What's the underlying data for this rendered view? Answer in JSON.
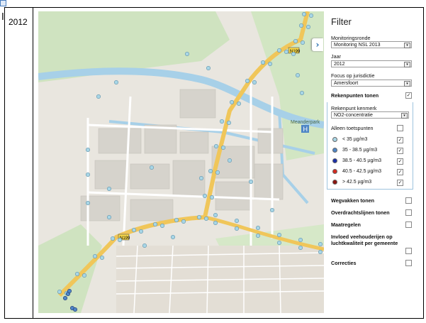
{
  "year_cell": {
    "value": "2012"
  },
  "map": {
    "area_labels": {
      "meanderpark": "Meanderpark",
      "hospital": "H"
    },
    "route_shields": [
      "N199",
      "N199"
    ],
    "point_color_low": "#a8d6e6",
    "road_color": "#f0c65a",
    "water_color": "#a7d0e8"
  },
  "filter": {
    "title": "Filter",
    "monitoringsronde_label": "Monitoringsronde",
    "monitoringsronde_value": "Monitoring NSL 2013",
    "jaar_label": "Jaar",
    "jaar_value": "2012",
    "jurisdictie_label": "Focus op jurisdictie",
    "jurisdictie_value": "Amersfoort",
    "rekenpunten_label": "Rekenpunten tonen",
    "kenmerk_label": "Rekenpunt kenmerk",
    "kenmerk_value": "NO2-concentratie",
    "toetspunten_label": "Alleen toetspunten",
    "legend": [
      {
        "label": "< 35 µg/m3",
        "color": "#a8d6e6",
        "checked": "✓"
      },
      {
        "label": "35 - 38.5 µg/m3",
        "color": "#4f86c6",
        "checked": "✓"
      },
      {
        "label": "38.5 - 40.5 µg/m3",
        "color": "#1a2fa8",
        "checked": "✓"
      },
      {
        "label": "40.5 - 42.5 µg/m3",
        "color": "#d42a1f",
        "checked": "✓"
      },
      {
        "label": "> 42.5 µg/m3",
        "color": "#8c1410",
        "checked": "✓"
      }
    ],
    "wegvakken_label": "Wegvakken tonen",
    "overdracht_label": "Overdrachtslijnen tonen",
    "maatregelen_label": "Maatregelen",
    "invloed_label_1": "Invloed veehouderijen op",
    "invloed_label_2": "luchtkwaliteit per gemeente",
    "correcties_label": "Correcties",
    "checked_mark": "✓",
    "arrow_glyph": "▾"
  },
  "toggle": {
    "glyph": "›"
  },
  "cursor": {
    "glyph": "I"
  }
}
